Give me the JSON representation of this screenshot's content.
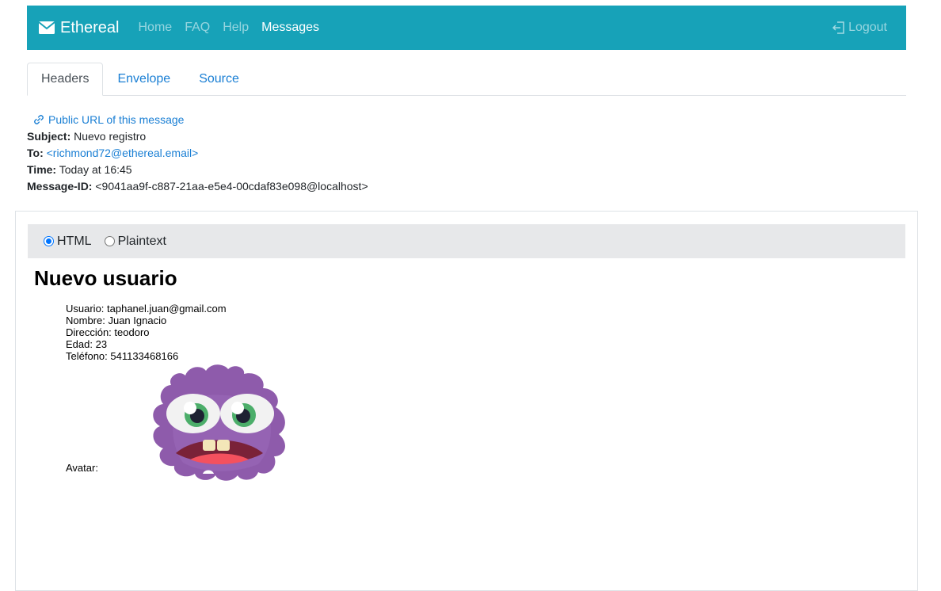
{
  "navbar": {
    "brand": "Ethereal",
    "links": [
      "Home",
      "FAQ",
      "Help",
      "Messages"
    ],
    "active_link": "Messages",
    "logout": "Logout",
    "bg_color": "#17a2b8"
  },
  "tabs": [
    "Headers",
    "Envelope",
    "Source"
  ],
  "active_tab": "Headers",
  "meta": {
    "public_url": "Public URL of this message",
    "subject_label": "Subject:",
    "subject": "Nuevo registro",
    "to_label": "To:",
    "to": "<richmond72@ethereal.email>",
    "time_label": "Time:",
    "time": "Today at 16:45",
    "message_id_label": "Message-ID:",
    "message_id": "<9041aa9f-c887-21aa-e5e4-00cdaf83e098@localhost>"
  },
  "view_switch": {
    "html": "HTML",
    "plaintext": "Plaintext",
    "selected": "HTML"
  },
  "message": {
    "heading": "Nuevo usuario",
    "lines": [
      "Usuario: taphanel.juan@gmail.com",
      "Nombre: Juan Ignacio",
      "Dirección: teodoro",
      "Edad: 23",
      "Teléfono: 541133468166"
    ],
    "avatar_label": "Avatar:",
    "avatar_image": "purple-monster-avatar"
  }
}
